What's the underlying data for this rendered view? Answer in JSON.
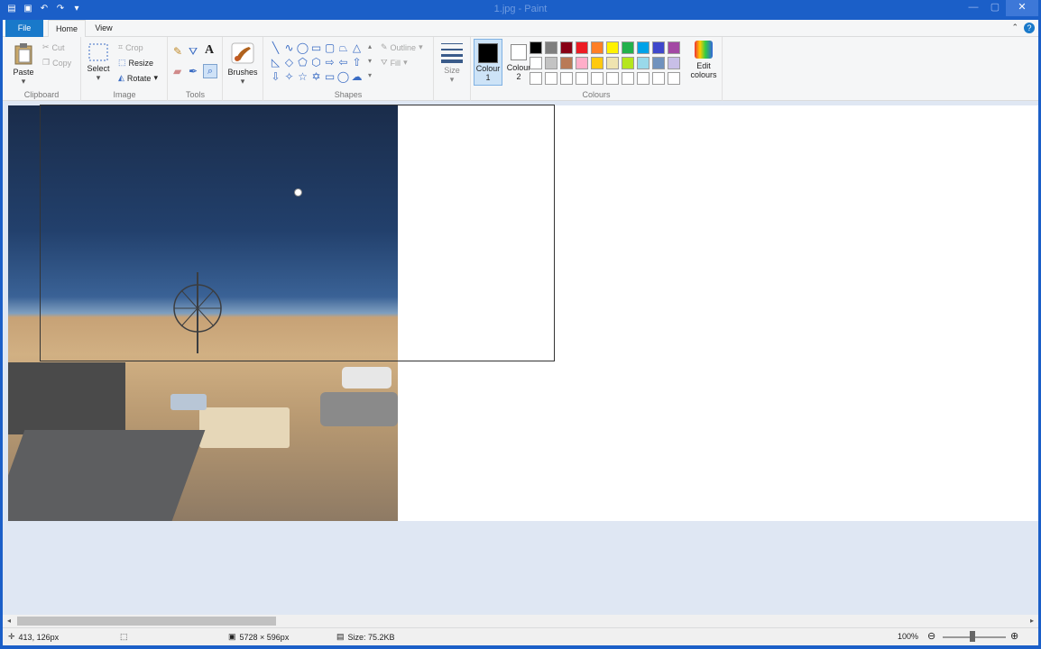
{
  "window": {
    "title": "1.jpg - Paint",
    "controls": {
      "minimize": "—",
      "maximize": "▢",
      "close": "✕"
    }
  },
  "quick_access": [
    "paint-icon",
    "save-icon",
    "undo-icon",
    "redo-icon",
    "customize-icon"
  ],
  "tabs": {
    "file": "File",
    "home": "Home",
    "view": "View"
  },
  "ribbon": {
    "clipboard": {
      "label": "Clipboard",
      "paste": "Paste",
      "cut": "Cut",
      "copy": "Copy"
    },
    "image": {
      "label": "Image",
      "select": "Select",
      "crop": "Crop",
      "resize": "Resize",
      "rotate": "Rotate"
    },
    "tools": {
      "label": "Tools",
      "text_tool": "A"
    },
    "brushes": {
      "label": "Brushes"
    },
    "shapes": {
      "label": "Shapes",
      "outline": "Outline",
      "fill": "Fill"
    },
    "size": {
      "label": "Size"
    },
    "colours": {
      "label": "Colours",
      "colour1_line1": "Colour",
      "colour1_line2": "1",
      "colour2_line1": "Colour",
      "colour2_line2": "2",
      "edit_line1": "Edit",
      "edit_line2": "colours",
      "colour1_value": "#000000",
      "colour2_value": "#ffffff",
      "palette_row1": [
        "#000000",
        "#7f7f7f",
        "#880015",
        "#ed1c24",
        "#ff7f27",
        "#fff200",
        "#22b14c",
        "#00a2e8",
        "#3f48cc",
        "#a349a4"
      ],
      "palette_row2": [
        "#ffffff",
        "#c3c3c3",
        "#b97a57",
        "#ffaec9",
        "#ffc90e",
        "#efe4b0",
        "#b5e61d",
        "#99d9ea",
        "#7092be",
        "#c8bfe7"
      ],
      "palette_row3": [
        "#ffffff",
        "#ffffff",
        "#ffffff",
        "#ffffff",
        "#ffffff",
        "#ffffff",
        "#ffffff",
        "#ffffff",
        "#ffffff",
        "#ffffff"
      ]
    }
  },
  "statusbar": {
    "cursor_pos": "413, 126px",
    "image_size": "5728 × 596px",
    "file_size": "Size: 75.2KB",
    "zoom": "100%"
  }
}
